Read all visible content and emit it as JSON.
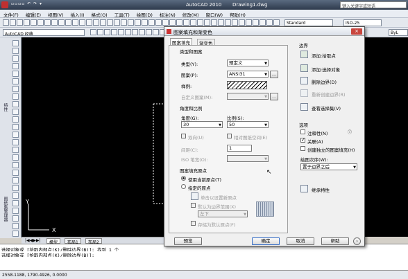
{
  "window": {
    "app_title": "AutoCAD 2010",
    "file": "Drawing1.dwg",
    "search_placeholder": "键入关键字或短语"
  },
  "menu": [
    "文件(F)",
    "编辑(E)",
    "视图(V)",
    "插入(I)",
    "格式(O)",
    "工具(T)",
    "绘图(D)",
    "标注(N)",
    "修改(M)",
    "窗口(W)",
    "帮助(H)"
  ],
  "toolbar": {
    "workspace": "AutoCAD 经典",
    "text_style": "Standard",
    "dim_style": "ISO-25",
    "layer_value": "ByL"
  },
  "side_labels": {
    "props": "特性",
    "sheetset": "图纸集管理器"
  },
  "layout_tabs": [
    "模型",
    "布局1",
    "布局2"
  ],
  "command_lines": [
    "选择对象或 [拾取内部点(K)/删除边界(B)]: 找到 1 个",
    "选择对象或 [拾取内部点(K)/删除边界(B)]:"
  ],
  "status": {
    "coords": "2558.1188, 1790.4926, 0.0000"
  },
  "dialog": {
    "title": "图案填充和渐变色",
    "tabs": [
      "图案填充",
      "渐变色"
    ],
    "type_group": {
      "title": "类型和图案",
      "type_label": "类型(Y):",
      "type_value": "预定义",
      "pattern_label": "图案(P):",
      "pattern_value": "ANSI31",
      "swatch_label": "样例:",
      "custom_label": "自定义图案(M):",
      "more_button": "..."
    },
    "angle_group": {
      "title": "角度和比例",
      "angle_label": "角度(G):",
      "angle_value": "30",
      "scale_label": "比例(S):",
      "scale_value": "50",
      "double_label": "双向(U)",
      "relative_label": "相对图纸空间(E)",
      "spacing_label": "间距(C):",
      "spacing_value": "1",
      "iso_label": "ISO 笔宽(O):"
    },
    "origin_group": {
      "title": "图案填充原点",
      "current_label": "使用当前原点(T)",
      "specified_label": "指定的原点",
      "click_label": "单击以设置新原点",
      "default_label": "默认为边界范围(X)",
      "corner_value": "左下",
      "store_label": "存储为默认原点(F)"
    },
    "boundary": {
      "title": "边界",
      "add_pick": "添加:拾取点",
      "add_select": "添加:选择对象",
      "remove": "删除边界(D)",
      "recreate": "重新创建边界(R)",
      "view": "查看选择集(V)"
    },
    "options": {
      "title": "选项",
      "annotative": "注释性(N)",
      "associative": "关联(A)",
      "separate": "创建独立的图案填充(H)",
      "draw_order_label": "绘图次序(W):",
      "draw_order_value": "置于边界之后"
    },
    "inherit": "继承特性",
    "buttons": {
      "preview": "预览",
      "ok": "确定",
      "cancel": "取消",
      "help": "帮助",
      "more": "›"
    }
  },
  "colors": {
    "canvas": "#000000",
    "title": "#2e3a4c",
    "accent": "#316ac5"
  }
}
